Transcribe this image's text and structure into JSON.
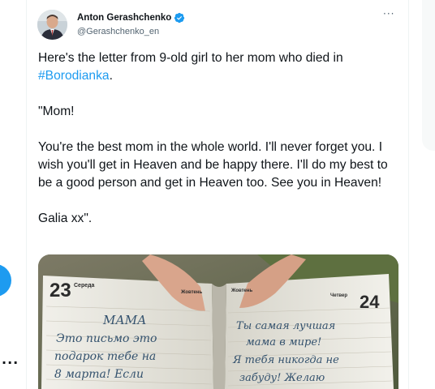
{
  "author": {
    "display_name": "Anton Gerashchenko",
    "handle": "@Gerashchenko_en",
    "verified": true
  },
  "tweet": {
    "line1_prefix": "Here's the letter from 9-old girl to her mom who died in",
    "hashtag": "#Borodianka",
    "line1_suffix": ".",
    "greeting": "\"Mom!",
    "body": "You're the best mom in the whole world. I'll never forget you. I wish you'll get in Heaven and be happy there. I'll do my best to be a good person and get in Heaven too. See you in Heaven!",
    "signoff": "Galia xx\"."
  },
  "more_label": "···",
  "left_rail": {
    "more_label": "···"
  },
  "media": {
    "left_page_number": "23",
    "left_page_day": "Середа",
    "right_page_number": "24",
    "right_page_day": "Четвер",
    "header_left": "Жовтень",
    "header_right": "Жовтень",
    "left_lines": [
      "МАМА",
      "Это письмо это",
      "подарок тебе на",
      "8 марта! Если"
    ],
    "right_lines": [
      "Ты самая лучшая",
      "мама в мире!",
      "Я тебя никогда не",
      "забуду! Желаю"
    ]
  },
  "colors": {
    "accent": "#1d9bf0",
    "text": "#0f1419",
    "secondary": "#536471"
  }
}
